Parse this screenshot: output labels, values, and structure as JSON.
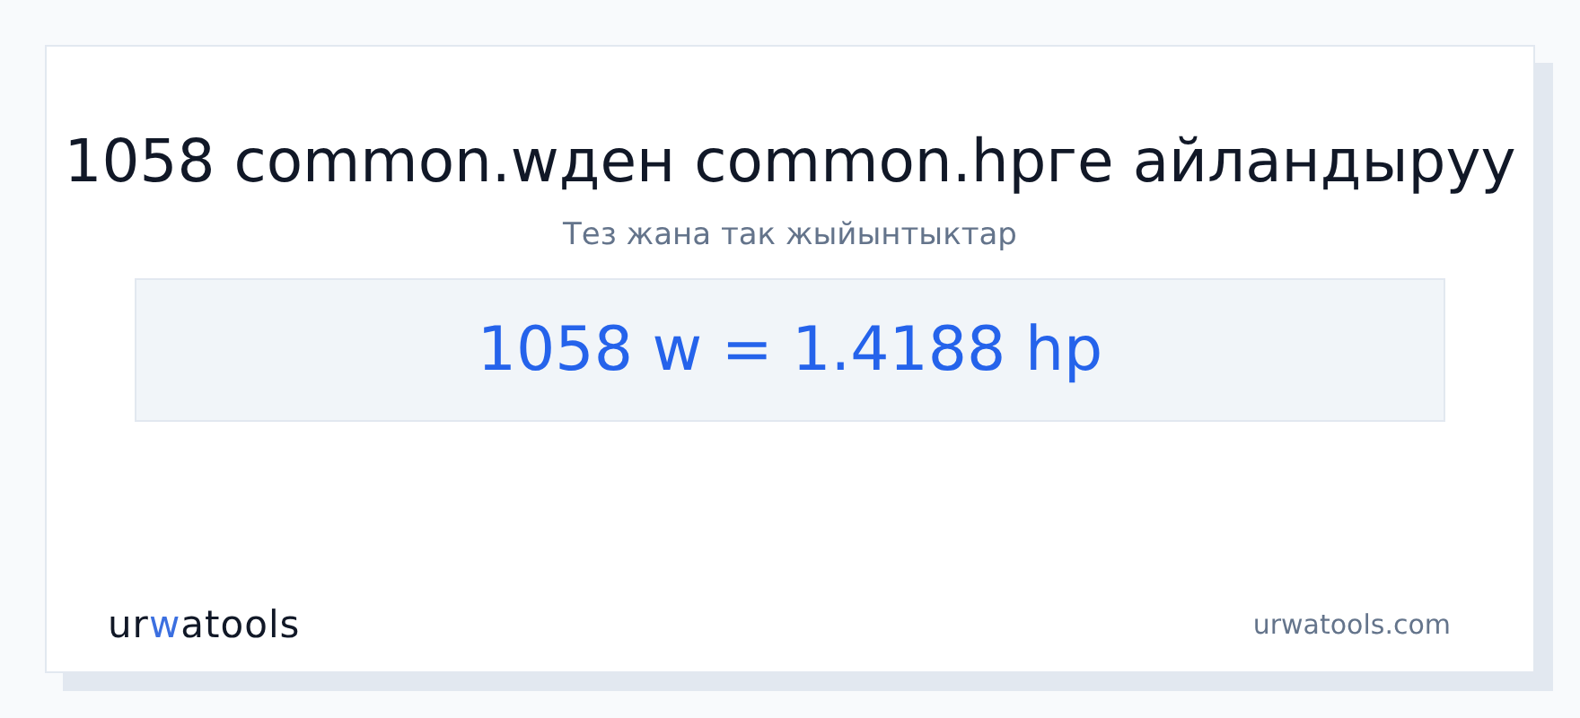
{
  "title": "1058 common.wден common.hpге айландыруу",
  "subtitle": "Тез жана так жыйынтыктар",
  "result": "1058 w = 1.4188 hp",
  "logo": [
    {
      "text": "ur",
      "accent": false
    },
    {
      "text": "w",
      "accent": true
    },
    {
      "text": "atools",
      "accent": false
    }
  ],
  "site": "urwatools.com"
}
